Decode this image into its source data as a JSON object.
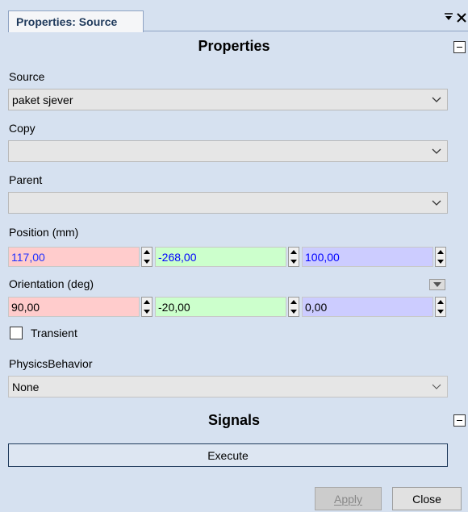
{
  "tab": {
    "title": "Properties: Source",
    "menu_glyph": "▾",
    "close_glyph": "×"
  },
  "properties": {
    "title": "Properties",
    "source": {
      "label": "Source",
      "value": "paket sjever"
    },
    "copy": {
      "label": "Copy",
      "value": ""
    },
    "parent": {
      "label": "Parent",
      "value": ""
    },
    "position": {
      "label": "Position (mm)",
      "x": "117,00",
      "y": "-268,00",
      "z": "100,00"
    },
    "orientation": {
      "label": "Orientation (deg)",
      "x": "90,00",
      "y": "-20,00",
      "z": "0,00"
    },
    "transient": {
      "label": "Transient",
      "checked": false
    },
    "physics": {
      "label": "PhysicsBehavior",
      "value": "None"
    }
  },
  "signals": {
    "title": "Signals",
    "execute_label": "Execute"
  },
  "footer": {
    "apply_label": "Apply",
    "close_label": "Close"
  },
  "colors": {
    "panel_bg": "#d6e1f0",
    "x_field": "#ffcccc",
    "y_field": "#ccffcc",
    "z_field": "#ccccff",
    "y_text": "#0000ff"
  }
}
